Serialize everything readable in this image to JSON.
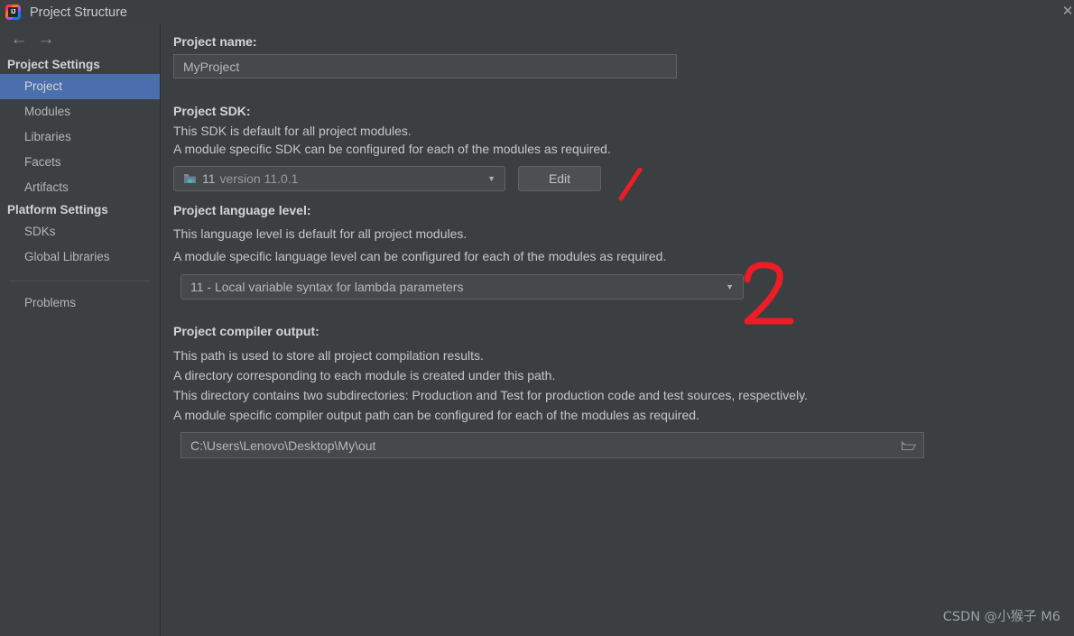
{
  "window": {
    "title": "Project Structure",
    "logo_icon": "intellij-idea-logo-icon",
    "close_icon": "✕"
  },
  "nav": {
    "back_icon": "←",
    "forward_icon": "→"
  },
  "sidebar": {
    "groups": [
      {
        "header": "Project Settings",
        "items": [
          {
            "label": "Project",
            "selected": true
          },
          {
            "label": "Modules",
            "selected": false
          },
          {
            "label": "Libraries",
            "selected": false
          },
          {
            "label": "Facets",
            "selected": false
          },
          {
            "label": "Artifacts",
            "selected": false
          }
        ]
      },
      {
        "header": "Platform Settings",
        "items": [
          {
            "label": "SDKs",
            "selected": false
          },
          {
            "label": "Global Libraries",
            "selected": false
          }
        ]
      }
    ],
    "problems_label": "Problems"
  },
  "main": {
    "project_name": {
      "label": "Project name:",
      "value": "MyProject"
    },
    "project_sdk": {
      "label": "Project SDK:",
      "desc_lines": [
        "This SDK is default for all project modules.",
        "A module specific SDK can be configured for each of the modules as required."
      ],
      "selected_name": "11",
      "selected_version": "version 11.0.1",
      "icon": "java-sdk-folder-icon",
      "dropdown_arrow": "▼",
      "edit_button": "Edit"
    },
    "language_level": {
      "label": "Project language level:",
      "desc_lines": [
        "This language level is default for all project modules.",
        "A module specific language level can be configured for each of the modules as required."
      ],
      "selected": "11 - Local variable syntax for lambda parameters",
      "dropdown_arrow": "▼"
    },
    "compiler_output": {
      "label": "Project compiler output:",
      "desc_lines": [
        "This path is used to store all project compilation results.",
        "A directory corresponding to each module is created under this path.",
        "This directory contains two subdirectories: Production and Test for production code and test sources, respectively.",
        "A module specific compiler output path can be configured for each of the modules as required."
      ],
      "value": "C:\\Users\\Lenovo\\Desktop\\My\\out",
      "browse_icon": "folder-browse-icon"
    }
  },
  "annotations": [
    {
      "id": "annotation-1",
      "text": "1",
      "color": "#ee1c25"
    },
    {
      "id": "annotation-2",
      "text": "2",
      "color": "#ee1c25"
    }
  ],
  "watermark": {
    "text": "CSDN @小猴子 M6"
  },
  "colors": {
    "background": "#3c3f41",
    "sidebar_background": "#3c4043",
    "selection_blue": "#4b6eaf",
    "field_background": "#45494a",
    "border": "#5e6366",
    "annotation_red": "#ee1c25"
  }
}
